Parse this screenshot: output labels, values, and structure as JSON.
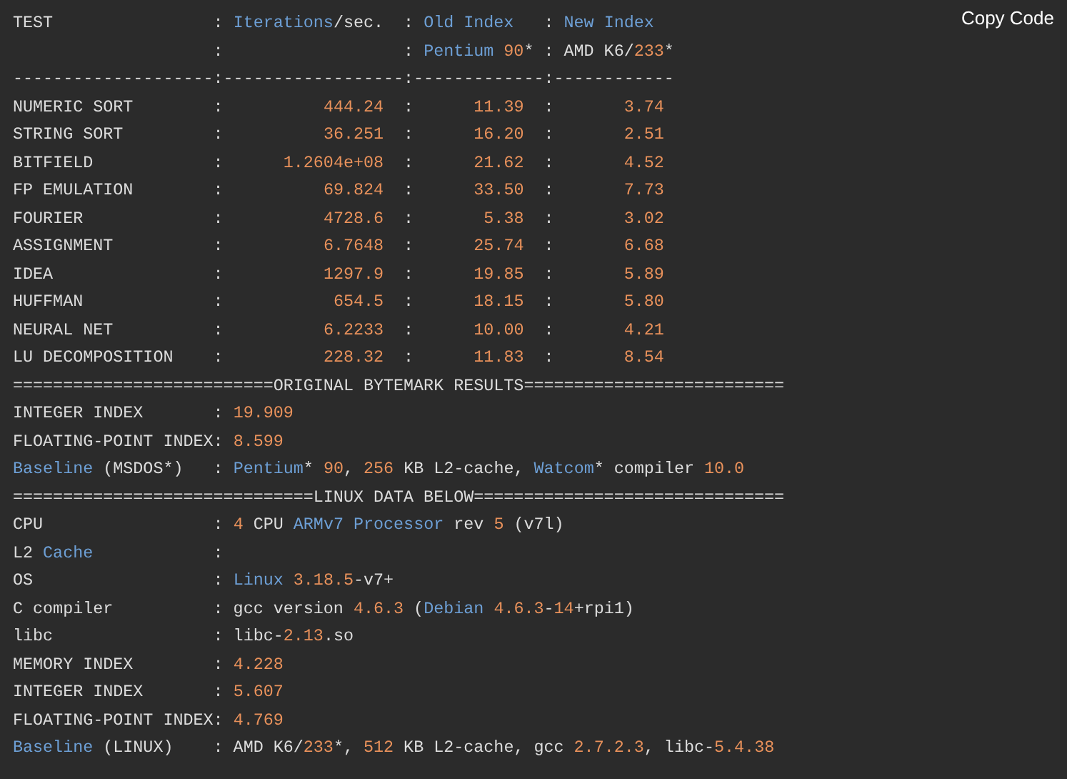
{
  "copy_button": "Copy Code",
  "lines": [
    {
      "kind": "code",
      "tokens": [
        {
          "text": "TEST                : ",
          "kind": "plain"
        },
        {
          "text": "Iterations",
          "kind": "name"
        },
        {
          "text": "/sec.  : ",
          "kind": "plain"
        },
        {
          "text": "Old Index",
          "kind": "name"
        },
        {
          "text": "   : ",
          "kind": "plain"
        },
        {
          "text": "New Index",
          "kind": "name"
        }
      ]
    },
    {
      "kind": "code",
      "tokens": [
        {
          "text": "                    :                  : ",
          "kind": "plain"
        },
        {
          "text": "Pentium ",
          "kind": "name"
        },
        {
          "text": "90",
          "kind": "number"
        },
        {
          "text": "* : AMD K6/",
          "kind": "plain"
        },
        {
          "text": "233",
          "kind": "number"
        },
        {
          "text": "*",
          "kind": "plain"
        }
      ]
    },
    {
      "kind": "code",
      "tokens": [
        {
          "text": "--------------------:------------------:-------------:------------",
          "kind": "plain"
        }
      ]
    },
    {
      "kind": "code",
      "tokens": [
        {
          "text": "NUMERIC SORT        :          ",
          "kind": "plain"
        },
        {
          "text": "444.24",
          "kind": "number"
        },
        {
          "text": "  :      ",
          "kind": "plain"
        },
        {
          "text": "11.39",
          "kind": "number"
        },
        {
          "text": "  :       ",
          "kind": "plain"
        },
        {
          "text": "3.74",
          "kind": "number"
        }
      ]
    },
    {
      "kind": "code",
      "tokens": [
        {
          "text": "STRING SORT         :          ",
          "kind": "plain"
        },
        {
          "text": "36.251",
          "kind": "number"
        },
        {
          "text": "  :      ",
          "kind": "plain"
        },
        {
          "text": "16.20",
          "kind": "number"
        },
        {
          "text": "  :       ",
          "kind": "plain"
        },
        {
          "text": "2.51",
          "kind": "number"
        }
      ]
    },
    {
      "kind": "code",
      "tokens": [
        {
          "text": "BITFIELD            :      ",
          "kind": "plain"
        },
        {
          "text": "1.2604e+08",
          "kind": "number"
        },
        {
          "text": "  :      ",
          "kind": "plain"
        },
        {
          "text": "21.62",
          "kind": "number"
        },
        {
          "text": "  :       ",
          "kind": "plain"
        },
        {
          "text": "4.52",
          "kind": "number"
        }
      ]
    },
    {
      "kind": "code",
      "tokens": [
        {
          "text": "FP EMULATION        :          ",
          "kind": "plain"
        },
        {
          "text": "69.824",
          "kind": "number"
        },
        {
          "text": "  :      ",
          "kind": "plain"
        },
        {
          "text": "33.50",
          "kind": "number"
        },
        {
          "text": "  :       ",
          "kind": "plain"
        },
        {
          "text": "7.73",
          "kind": "number"
        }
      ]
    },
    {
      "kind": "code",
      "tokens": [
        {
          "text": "FOURIER             :          ",
          "kind": "plain"
        },
        {
          "text": "4728.6",
          "kind": "number"
        },
        {
          "text": "  :       ",
          "kind": "plain"
        },
        {
          "text": "5.38",
          "kind": "number"
        },
        {
          "text": "  :       ",
          "kind": "plain"
        },
        {
          "text": "3.02",
          "kind": "number"
        }
      ]
    },
    {
      "kind": "code",
      "tokens": [
        {
          "text": "ASSIGNMENT          :          ",
          "kind": "plain"
        },
        {
          "text": "6.7648",
          "kind": "number"
        },
        {
          "text": "  :      ",
          "kind": "plain"
        },
        {
          "text": "25.74",
          "kind": "number"
        },
        {
          "text": "  :       ",
          "kind": "plain"
        },
        {
          "text": "6.68",
          "kind": "number"
        }
      ]
    },
    {
      "kind": "code",
      "tokens": [
        {
          "text": "IDEA                :          ",
          "kind": "plain"
        },
        {
          "text": "1297.9",
          "kind": "number"
        },
        {
          "text": "  :      ",
          "kind": "plain"
        },
        {
          "text": "19.85",
          "kind": "number"
        },
        {
          "text": "  :       ",
          "kind": "plain"
        },
        {
          "text": "5.89",
          "kind": "number"
        }
      ]
    },
    {
      "kind": "code",
      "tokens": [
        {
          "text": "HUFFMAN             :           ",
          "kind": "plain"
        },
        {
          "text": "654.5",
          "kind": "number"
        },
        {
          "text": "  :      ",
          "kind": "plain"
        },
        {
          "text": "18.15",
          "kind": "number"
        },
        {
          "text": "  :       ",
          "kind": "plain"
        },
        {
          "text": "5.80",
          "kind": "number"
        }
      ]
    },
    {
      "kind": "code",
      "tokens": [
        {
          "text": "NEURAL NET          :          ",
          "kind": "plain"
        },
        {
          "text": "6.2233",
          "kind": "number"
        },
        {
          "text": "  :      ",
          "kind": "plain"
        },
        {
          "text": "10.00",
          "kind": "number"
        },
        {
          "text": "  :       ",
          "kind": "plain"
        },
        {
          "text": "4.21",
          "kind": "number"
        }
      ]
    },
    {
      "kind": "code",
      "tokens": [
        {
          "text": "LU DECOMPOSITION    :          ",
          "kind": "plain"
        },
        {
          "text": "228.32",
          "kind": "number"
        },
        {
          "text": "  :      ",
          "kind": "plain"
        },
        {
          "text": "11.83",
          "kind": "number"
        },
        {
          "text": "  :       ",
          "kind": "plain"
        },
        {
          "text": "8.54",
          "kind": "number"
        }
      ]
    },
    {
      "kind": "code",
      "tokens": [
        {
          "text": "==========================ORIGINAL BYTEMARK RESULTS==========================",
          "kind": "plain"
        }
      ]
    },
    {
      "kind": "code",
      "tokens": [
        {
          "text": "INTEGER INDEX       : ",
          "kind": "plain"
        },
        {
          "text": "19.909",
          "kind": "number"
        }
      ]
    },
    {
      "kind": "code",
      "tokens": [
        {
          "text": "FLOATING-POINT INDEX: ",
          "kind": "plain"
        },
        {
          "text": "8.599",
          "kind": "number"
        }
      ]
    },
    {
      "kind": "code",
      "tokens": [
        {
          "text": "Baseline",
          "kind": "name"
        },
        {
          "text": " (MSDOS*)   : ",
          "kind": "plain"
        },
        {
          "text": "Pentium",
          "kind": "name"
        },
        {
          "text": "* ",
          "kind": "plain"
        },
        {
          "text": "90",
          "kind": "number"
        },
        {
          "text": ", ",
          "kind": "plain"
        },
        {
          "text": "256",
          "kind": "number"
        },
        {
          "text": " KB L2-cache, ",
          "kind": "plain"
        },
        {
          "text": "Watcom",
          "kind": "name"
        },
        {
          "text": "* compiler ",
          "kind": "plain"
        },
        {
          "text": "10.0",
          "kind": "number"
        }
      ]
    },
    {
      "kind": "code",
      "tokens": [
        {
          "text": "==============================LINUX DATA BELOW===============================",
          "kind": "plain"
        }
      ]
    },
    {
      "kind": "code",
      "tokens": [
        {
          "text": "CPU                 : ",
          "kind": "plain"
        },
        {
          "text": "4",
          "kind": "number"
        },
        {
          "text": " CPU ",
          "kind": "plain"
        },
        {
          "text": "ARMv7 Processor",
          "kind": "name"
        },
        {
          "text": " rev ",
          "kind": "plain"
        },
        {
          "text": "5",
          "kind": "number"
        },
        {
          "text": " (v7l)",
          "kind": "plain"
        }
      ]
    },
    {
      "kind": "code",
      "tokens": [
        {
          "text": "L2 ",
          "kind": "plain"
        },
        {
          "text": "Cache",
          "kind": "name"
        },
        {
          "text": "            :",
          "kind": "plain"
        }
      ]
    },
    {
      "kind": "code",
      "tokens": [
        {
          "text": "OS                  : ",
          "kind": "plain"
        },
        {
          "text": "Linux ",
          "kind": "name"
        },
        {
          "text": "3.18.5",
          "kind": "number"
        },
        {
          "text": "-v7+",
          "kind": "plain"
        }
      ]
    },
    {
      "kind": "code",
      "tokens": [
        {
          "text": "C compiler          : gcc version ",
          "kind": "plain"
        },
        {
          "text": "4.6.3",
          "kind": "number"
        },
        {
          "text": " (",
          "kind": "plain"
        },
        {
          "text": "Debian ",
          "kind": "name"
        },
        {
          "text": "4.6.3",
          "kind": "number"
        },
        {
          "text": "-",
          "kind": "plain"
        },
        {
          "text": "14",
          "kind": "number"
        },
        {
          "text": "+rpi1)",
          "kind": "plain"
        }
      ]
    },
    {
      "kind": "code",
      "tokens": [
        {
          "text": "libc                : libc-",
          "kind": "plain"
        },
        {
          "text": "2.13",
          "kind": "number"
        },
        {
          "text": ".so",
          "kind": "plain"
        }
      ]
    },
    {
      "kind": "code",
      "tokens": [
        {
          "text": "MEMORY INDEX        : ",
          "kind": "plain"
        },
        {
          "text": "4.228",
          "kind": "number"
        }
      ]
    },
    {
      "kind": "code",
      "tokens": [
        {
          "text": "INTEGER INDEX       : ",
          "kind": "plain"
        },
        {
          "text": "5.607",
          "kind": "number"
        }
      ]
    },
    {
      "kind": "code",
      "tokens": [
        {
          "text": "FLOATING-POINT INDEX: ",
          "kind": "plain"
        },
        {
          "text": "4.769",
          "kind": "number"
        }
      ]
    },
    {
      "kind": "code",
      "tokens": [
        {
          "text": "Baseline",
          "kind": "name"
        },
        {
          "text": " (LINUX)    : AMD K6/",
          "kind": "plain"
        },
        {
          "text": "233",
          "kind": "number"
        },
        {
          "text": "*, ",
          "kind": "plain"
        },
        {
          "text": "512",
          "kind": "number"
        },
        {
          "text": " KB L2-cache, gcc ",
          "kind": "plain"
        },
        {
          "text": "2.7.2.3",
          "kind": "number"
        },
        {
          "text": ", libc-",
          "kind": "plain"
        },
        {
          "text": "5.4.38",
          "kind": "number"
        }
      ]
    }
  ]
}
